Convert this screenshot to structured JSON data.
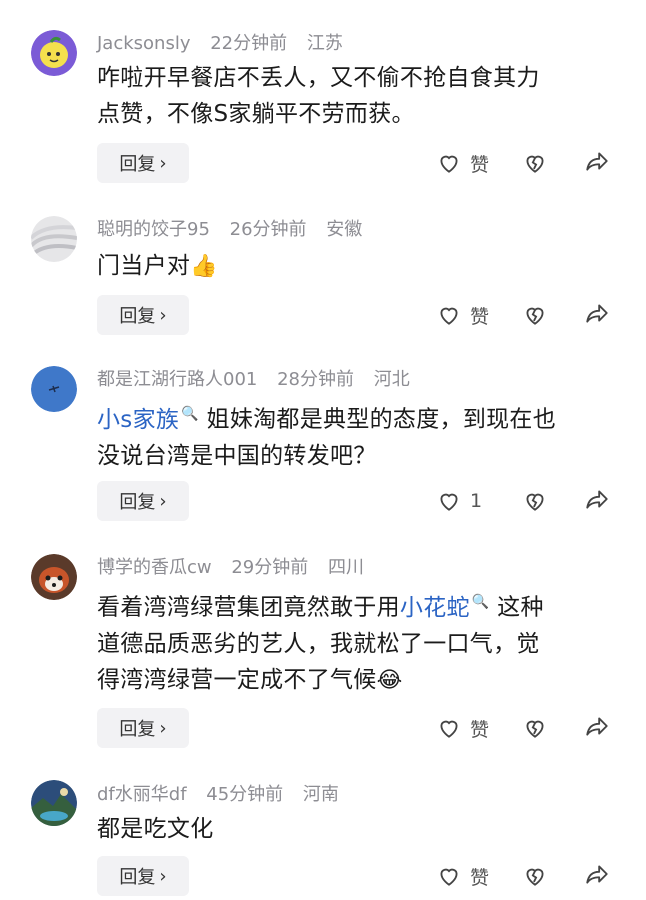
{
  "comments": [
    {
      "user": "Jacksonsly",
      "time": "22分钟前",
      "location": "江苏",
      "text_lines": [
        "咋啦开早餐店不丢人，又不偷不抢自食其力",
        "点赞，不像S家躺平不劳而获。"
      ],
      "like_label": "赞",
      "avatar_icon": "lemon-avatar-icon"
    },
    {
      "user": "聪明的饺子95",
      "time": "26分钟前",
      "location": "安徽",
      "text": "门当户对",
      "emoji": "👍",
      "like_label": "赞",
      "avatar_icon": "grey-wave-avatar-icon"
    },
    {
      "user": "都是江湖行路人001",
      "time": "28分钟前",
      "location": "河北",
      "mention": "小s家族",
      "text_line1_rest": " 姐妹淘都是典型的态度，到现在也",
      "text_line2": "没说台湾是中国的转发吧？",
      "like_label": "1",
      "avatar_icon": "blue-sky-plane-avatar-icon"
    },
    {
      "user": "博学的香瓜cw",
      "time": "29分钟前",
      "location": "四川",
      "line1_before": "看着湾湾绿营集团竟然敢于用",
      "mention": "小花蛇",
      "line1_after": " 这种",
      "line2": "道德品质恶劣的艺人，我就松了一口气，觉",
      "line3": "得湾湾绿营一定成不了气候",
      "emoji": "😂",
      "like_label": "赞",
      "avatar_icon": "red-panda-avatar-icon"
    },
    {
      "user": "df水丽华df",
      "time": "45分钟前",
      "location": "河南",
      "text": "都是吃文化",
      "like_label": "赞",
      "avatar_icon": "landscape-avatar-icon"
    }
  ],
  "reply_label": "回复",
  "reply_chevron": "›",
  "mention_icon": "🔍"
}
